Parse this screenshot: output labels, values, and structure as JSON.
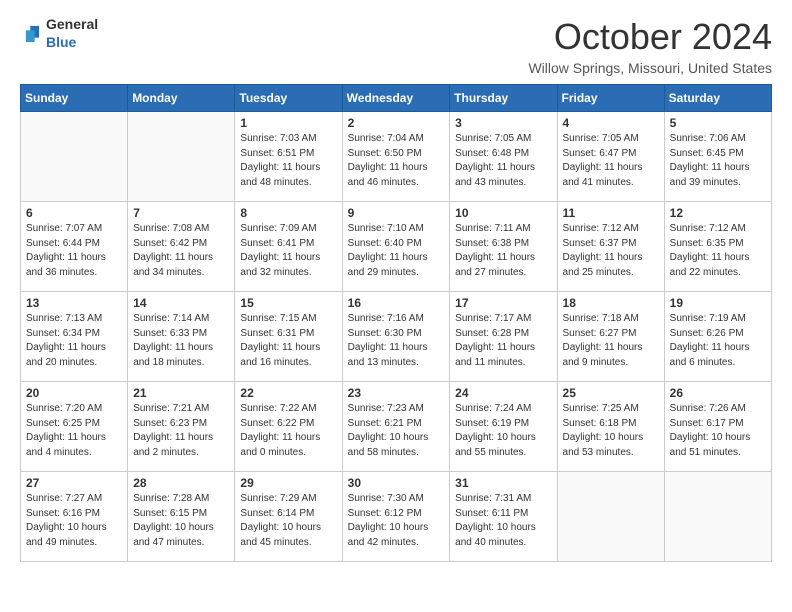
{
  "header": {
    "logo_general": "General",
    "logo_blue": "Blue",
    "title": "October 2024",
    "location": "Willow Springs, Missouri, United States"
  },
  "weekdays": [
    "Sunday",
    "Monday",
    "Tuesday",
    "Wednesday",
    "Thursday",
    "Friday",
    "Saturday"
  ],
  "weeks": [
    [
      {
        "day": "",
        "content": ""
      },
      {
        "day": "",
        "content": ""
      },
      {
        "day": "1",
        "content": "Sunrise: 7:03 AM\nSunset: 6:51 PM\nDaylight: 11 hours and 48 minutes."
      },
      {
        "day": "2",
        "content": "Sunrise: 7:04 AM\nSunset: 6:50 PM\nDaylight: 11 hours and 46 minutes."
      },
      {
        "day": "3",
        "content": "Sunrise: 7:05 AM\nSunset: 6:48 PM\nDaylight: 11 hours and 43 minutes."
      },
      {
        "day": "4",
        "content": "Sunrise: 7:05 AM\nSunset: 6:47 PM\nDaylight: 11 hours and 41 minutes."
      },
      {
        "day": "5",
        "content": "Sunrise: 7:06 AM\nSunset: 6:45 PM\nDaylight: 11 hours and 39 minutes."
      }
    ],
    [
      {
        "day": "6",
        "content": "Sunrise: 7:07 AM\nSunset: 6:44 PM\nDaylight: 11 hours and 36 minutes."
      },
      {
        "day": "7",
        "content": "Sunrise: 7:08 AM\nSunset: 6:42 PM\nDaylight: 11 hours and 34 minutes."
      },
      {
        "day": "8",
        "content": "Sunrise: 7:09 AM\nSunset: 6:41 PM\nDaylight: 11 hours and 32 minutes."
      },
      {
        "day": "9",
        "content": "Sunrise: 7:10 AM\nSunset: 6:40 PM\nDaylight: 11 hours and 29 minutes."
      },
      {
        "day": "10",
        "content": "Sunrise: 7:11 AM\nSunset: 6:38 PM\nDaylight: 11 hours and 27 minutes."
      },
      {
        "day": "11",
        "content": "Sunrise: 7:12 AM\nSunset: 6:37 PM\nDaylight: 11 hours and 25 minutes."
      },
      {
        "day": "12",
        "content": "Sunrise: 7:12 AM\nSunset: 6:35 PM\nDaylight: 11 hours and 22 minutes."
      }
    ],
    [
      {
        "day": "13",
        "content": "Sunrise: 7:13 AM\nSunset: 6:34 PM\nDaylight: 11 hours and 20 minutes."
      },
      {
        "day": "14",
        "content": "Sunrise: 7:14 AM\nSunset: 6:33 PM\nDaylight: 11 hours and 18 minutes."
      },
      {
        "day": "15",
        "content": "Sunrise: 7:15 AM\nSunset: 6:31 PM\nDaylight: 11 hours and 16 minutes."
      },
      {
        "day": "16",
        "content": "Sunrise: 7:16 AM\nSunset: 6:30 PM\nDaylight: 11 hours and 13 minutes."
      },
      {
        "day": "17",
        "content": "Sunrise: 7:17 AM\nSunset: 6:28 PM\nDaylight: 11 hours and 11 minutes."
      },
      {
        "day": "18",
        "content": "Sunrise: 7:18 AM\nSunset: 6:27 PM\nDaylight: 11 hours and 9 minutes."
      },
      {
        "day": "19",
        "content": "Sunrise: 7:19 AM\nSunset: 6:26 PM\nDaylight: 11 hours and 6 minutes."
      }
    ],
    [
      {
        "day": "20",
        "content": "Sunrise: 7:20 AM\nSunset: 6:25 PM\nDaylight: 11 hours and 4 minutes."
      },
      {
        "day": "21",
        "content": "Sunrise: 7:21 AM\nSunset: 6:23 PM\nDaylight: 11 hours and 2 minutes."
      },
      {
        "day": "22",
        "content": "Sunrise: 7:22 AM\nSunset: 6:22 PM\nDaylight: 11 hours and 0 minutes."
      },
      {
        "day": "23",
        "content": "Sunrise: 7:23 AM\nSunset: 6:21 PM\nDaylight: 10 hours and 58 minutes."
      },
      {
        "day": "24",
        "content": "Sunrise: 7:24 AM\nSunset: 6:19 PM\nDaylight: 10 hours and 55 minutes."
      },
      {
        "day": "25",
        "content": "Sunrise: 7:25 AM\nSunset: 6:18 PM\nDaylight: 10 hours and 53 minutes."
      },
      {
        "day": "26",
        "content": "Sunrise: 7:26 AM\nSunset: 6:17 PM\nDaylight: 10 hours and 51 minutes."
      }
    ],
    [
      {
        "day": "27",
        "content": "Sunrise: 7:27 AM\nSunset: 6:16 PM\nDaylight: 10 hours and 49 minutes."
      },
      {
        "day": "28",
        "content": "Sunrise: 7:28 AM\nSunset: 6:15 PM\nDaylight: 10 hours and 47 minutes."
      },
      {
        "day": "29",
        "content": "Sunrise: 7:29 AM\nSunset: 6:14 PM\nDaylight: 10 hours and 45 minutes."
      },
      {
        "day": "30",
        "content": "Sunrise: 7:30 AM\nSunset: 6:12 PM\nDaylight: 10 hours and 42 minutes."
      },
      {
        "day": "31",
        "content": "Sunrise: 7:31 AM\nSunset: 6:11 PM\nDaylight: 10 hours and 40 minutes."
      },
      {
        "day": "",
        "content": ""
      },
      {
        "day": "",
        "content": ""
      }
    ]
  ]
}
